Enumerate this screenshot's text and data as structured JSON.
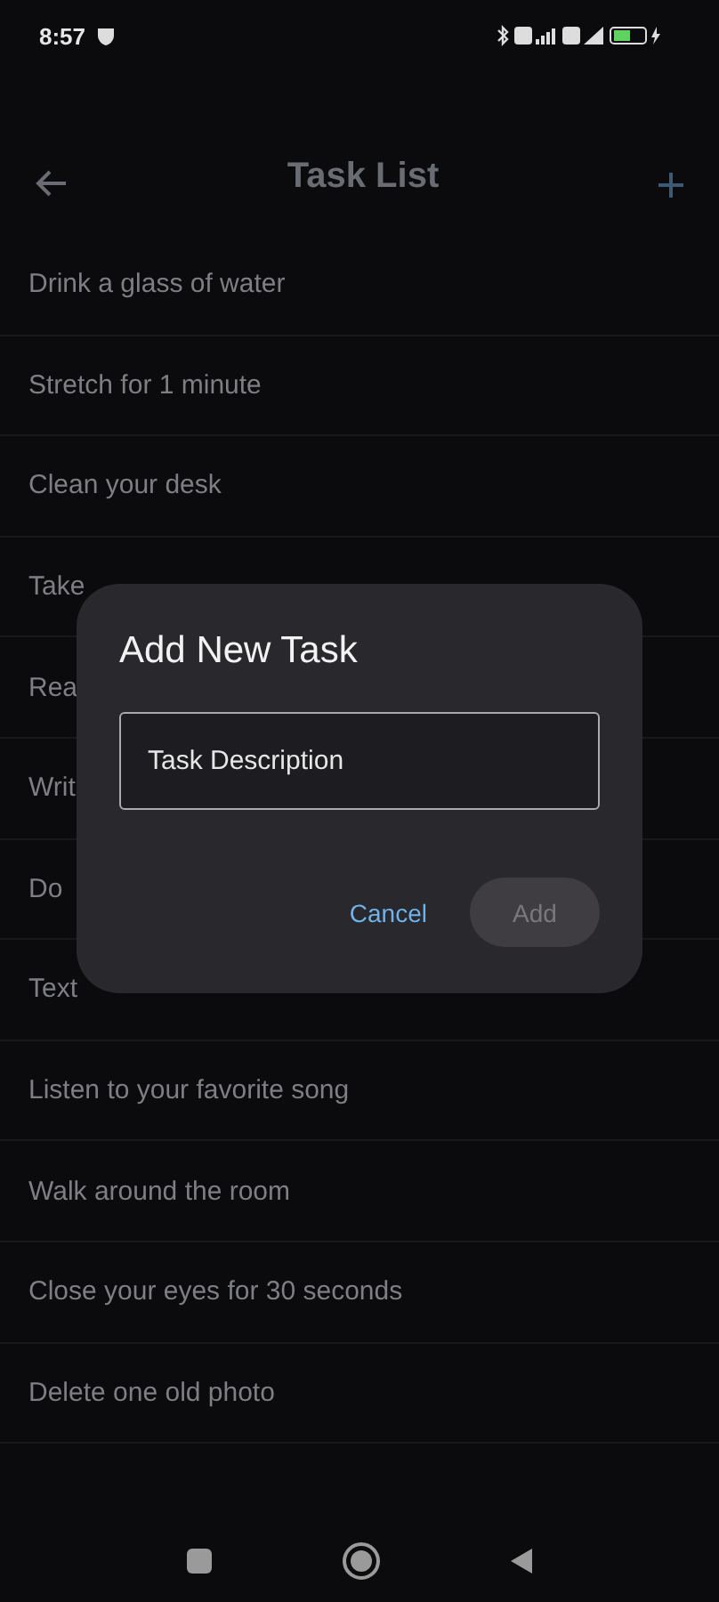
{
  "status_bar": {
    "time": "8:57"
  },
  "app_bar": {
    "title": "Task List"
  },
  "tasks": [
    {
      "text": "Drink a glass of water"
    },
    {
      "text": "Stretch for 1 minute"
    },
    {
      "text": "Clean your desk"
    },
    {
      "text": "Take"
    },
    {
      "text": "Rea"
    },
    {
      "text": "Writ"
    },
    {
      "text": "Do"
    },
    {
      "text": "Text"
    },
    {
      "text": "Listen to your favorite song"
    },
    {
      "text": "Walk around the room"
    },
    {
      "text": "Close your eyes for 30 seconds"
    },
    {
      "text": "Delete one old photo"
    }
  ],
  "dialog": {
    "title": "Add New Task",
    "field": {
      "placeholder": "Task Description"
    },
    "buttons": [
      {
        "kind": "text",
        "label": "Cancel",
        "disabled": false
      },
      {
        "kind": "filled",
        "label": "Add",
        "disabled": true
      }
    ]
  }
}
